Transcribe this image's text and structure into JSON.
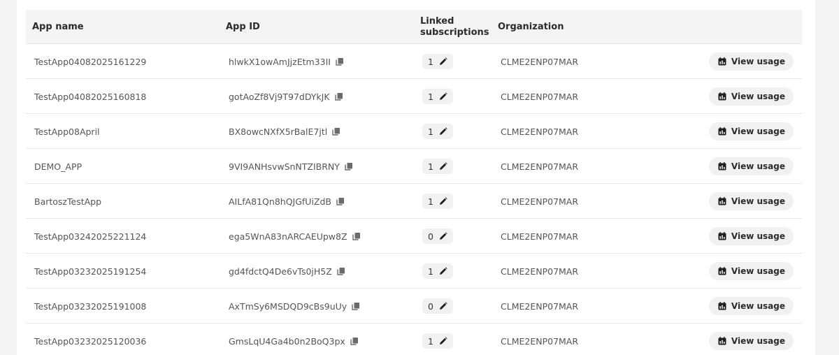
{
  "table": {
    "headers": {
      "name": "App name",
      "id": "App ID",
      "linked_line1": "Linked",
      "linked_line2": "subscriptions",
      "org": "Organization"
    },
    "rows": [
      {
        "name": "TestApp04082025161229",
        "id": "hlwkX1owAmJjzEtm33II",
        "linked": "1",
        "org": "CLME2ENP07MAR",
        "action": "View usage"
      },
      {
        "name": "TestApp04082025160818",
        "id": "gotAoZf8Vj9T97dDYkJK",
        "linked": "1",
        "org": "CLME2ENP07MAR",
        "action": "View usage"
      },
      {
        "name": "TestApp08April",
        "id": "BX8owcNXfX5rBalE7jtl",
        "linked": "1",
        "org": "CLME2ENP07MAR",
        "action": "View usage"
      },
      {
        "name": "DEMO_APP",
        "id": "9VI9ANHsvwSnNTZIBRNY",
        "linked": "1",
        "org": "CLME2ENP07MAR",
        "action": "View usage"
      },
      {
        "name": "BartoszTestApp",
        "id": "AILfA81Qn8hQJGfUiZdB",
        "linked": "1",
        "org": "CLME2ENP07MAR",
        "action": "View usage"
      },
      {
        "name": "TestApp03242025221124",
        "id": "ega5WnA83nARCAEUpw8Z",
        "linked": "0",
        "org": "CLME2ENP07MAR",
        "action": "View usage"
      },
      {
        "name": "TestApp03232025191254",
        "id": "gd4fdctQ4De6vTs0jH5Z",
        "linked": "1",
        "org": "CLME2ENP07MAR",
        "action": "View usage"
      },
      {
        "name": "TestApp03232025191008",
        "id": "AxTmSy6MSDQD9cBs9uUy",
        "linked": "0",
        "org": "CLME2ENP07MAR",
        "action": "View usage"
      },
      {
        "name": "TestApp03232025120036",
        "id": "GmsLqU4Ga4b0n2BoQ3px",
        "linked": "1",
        "org": "CLME2ENP07MAR",
        "action": "View usage"
      }
    ]
  },
  "icons": {
    "copy": "copy-icon",
    "edit": "pencil-icon",
    "usage": "calendar-chart-icon"
  },
  "colors": {
    "header_bg": "#f4f4f4",
    "pill_bg": "#f1f1f1",
    "text": "#2f2f2f"
  }
}
